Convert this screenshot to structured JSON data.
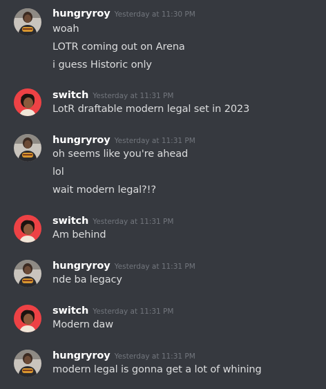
{
  "messages": [
    {
      "author": "hungryroy",
      "timestamp": "Yesterday at 11:30 PM",
      "avatar": "hungryroy-avatar",
      "lines": [
        "woah",
        "LOTR coming out on Arena",
        "i guess Historic only"
      ]
    },
    {
      "author": "switch",
      "timestamp": "Yesterday at 11:31 PM",
      "avatar": "switch-avatar",
      "lines": [
        "LotR draftable modern legal set in 2023"
      ]
    },
    {
      "author": "hungryroy",
      "timestamp": "Yesterday at 11:31 PM",
      "avatar": "hungryroy-avatar",
      "lines": [
        "oh seems like you're ahead",
        "lol",
        "wait modern legal?!?"
      ]
    },
    {
      "author": "switch",
      "timestamp": "Yesterday at 11:31 PM",
      "avatar": "switch-avatar",
      "lines": [
        "Am behind"
      ]
    },
    {
      "author": "hungryroy",
      "timestamp": "Yesterday at 11:31 PM",
      "avatar": "hungryroy-avatar",
      "lines": [
        "nde ba legacy"
      ]
    },
    {
      "author": "switch",
      "timestamp": "Yesterday at 11:31 PM",
      "avatar": "switch-avatar",
      "lines": [
        "Modern daw"
      ]
    },
    {
      "author": "hungryroy",
      "timestamp": "Yesterday at 11:31 PM",
      "avatar": "hungryroy-avatar",
      "lines": [
        "modern legal is gonna get a lot of whining"
      ]
    }
  ],
  "colors": {
    "background": "#36393f",
    "username": "#ffffff",
    "timestamp": "#72767d",
    "message_text": "#dcddde",
    "switch_avatar_bg": "#ed4245"
  }
}
